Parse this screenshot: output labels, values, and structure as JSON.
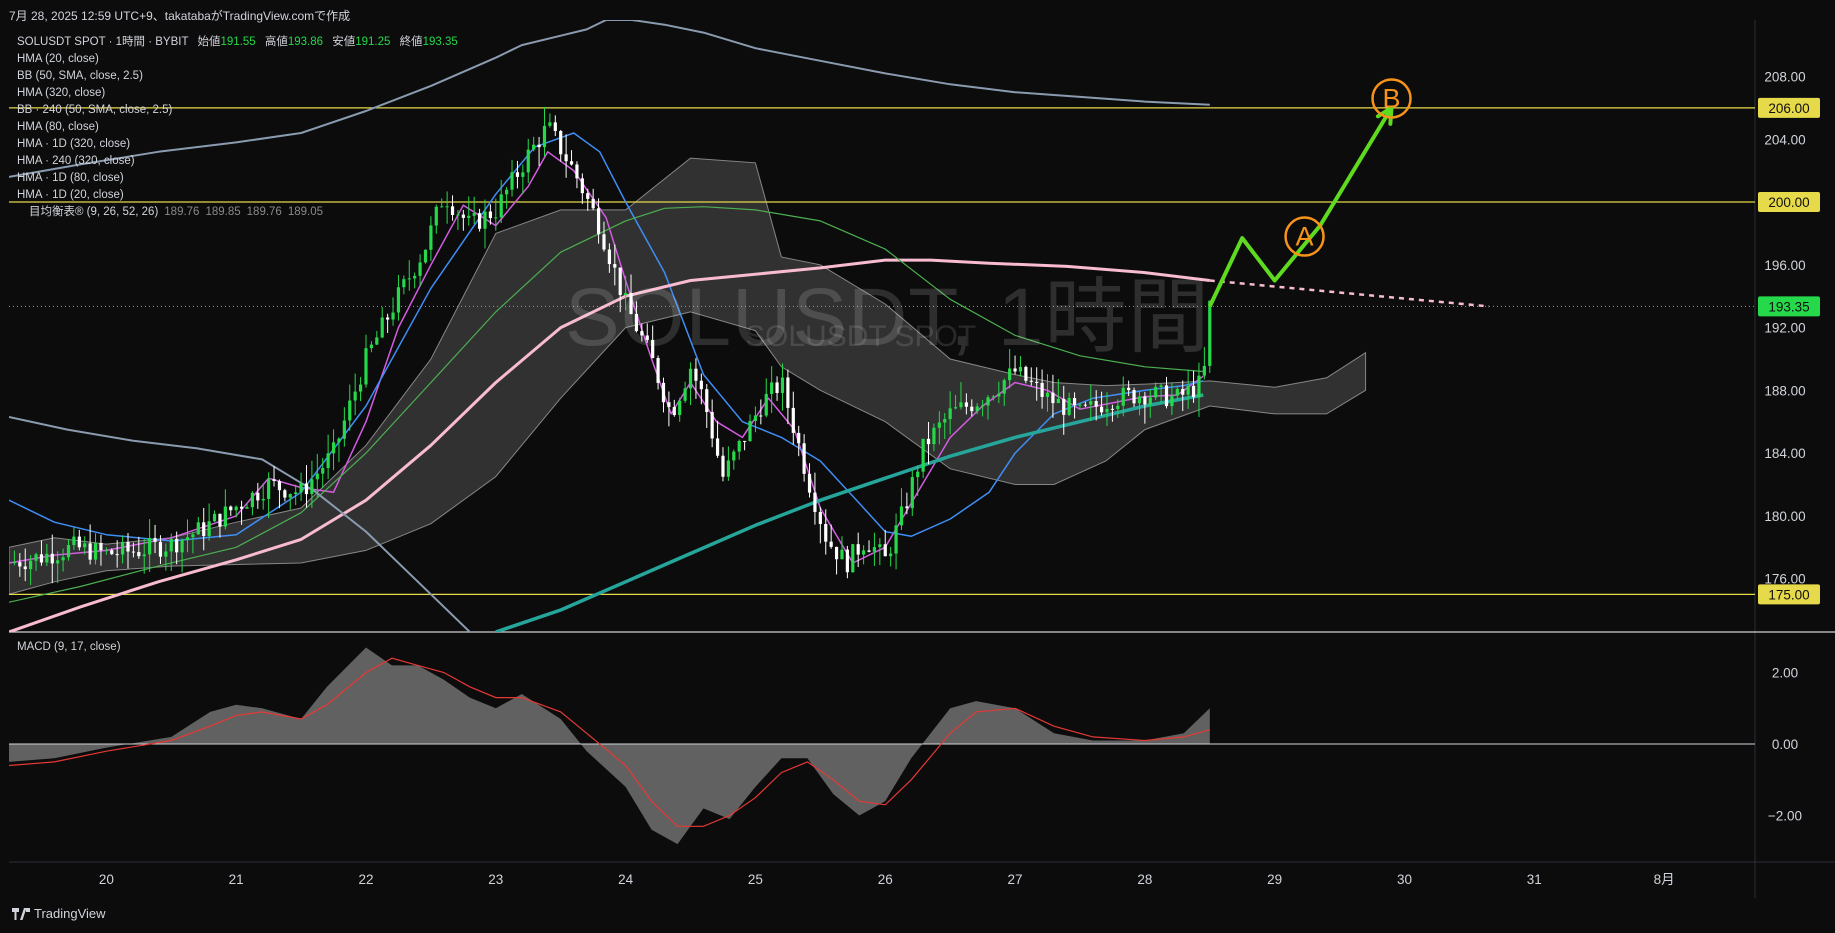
{
  "header": {
    "caption": "7月 28, 2025 12:59 UTC+9、takatabaがTradingView.comで作成"
  },
  "legend": {
    "symbol_line": "SOLUSDT SPOT · 1時間 · BYBIT",
    "open_label": "始値",
    "open": "191.55",
    "high_label": "高値",
    "high": "193.86",
    "low_label": "安値",
    "low": "191.25",
    "close_label": "終値",
    "close": "193.35",
    "indicators": [
      "HMA (20, close)",
      "BB (50, SMA, close, 2.5)",
      "HMA (320, close)",
      "BB · 240 (50, SMA, close, 2.5)",
      "HMA (80, close)",
      "HMA · 1D (320, close)",
      "HMA · 240 (320, close)",
      "HMA · 1D (80, close)",
      "HMA · 1D (20, close)"
    ],
    "ichimoku_label": "目均衡表® (9, 26, 52, 26)",
    "ichimoku_values": [
      "189.76",
      "189.85",
      "189.76",
      "189.05"
    ]
  },
  "macd_label": "MACD (9, 17, close)",
  "watermark": {
    "main": "SOLUSDT, 1時間",
    "sub": "SOLUSDT SPOT"
  },
  "footer": {
    "brand": "TradingView"
  },
  "colors": {
    "background": "#0c0c0c",
    "bull": "#26d94a",
    "bear": "#ffffff",
    "hma20": "#d35ce0",
    "hma80": "#3f8ef5",
    "hma320": "#f8bbd0",
    "bb_outer": "#8a9bb0",
    "bb_mid": "#4caf50",
    "teal": "#26a69a",
    "level": "#e6d94a",
    "projection": "#5edb1f",
    "label_orange": "#f7931a",
    "current_price_bg": "#26d94a"
  },
  "chart_data": [
    {
      "type": "candlestick",
      "title": "SOLUSDT, 1時間",
      "x_ticks": [
        "20",
        "21",
        "22",
        "23",
        "24",
        "25",
        "26",
        "27",
        "28",
        "29",
        "30",
        "31",
        "8月"
      ],
      "y_ticks": [
        176.0,
        180.0,
        184.0,
        188.0,
        192.0,
        196.0,
        200.0,
        204.0,
        208.0
      ],
      "y_tick_labels": [
        "176.00",
        "180.00",
        "184.00",
        "188.00",
        "192.00",
        "196.00",
        "200.00",
        "204.00",
        "208.00"
      ],
      "ylim": [
        172.6,
        211.6
      ],
      "xlim": [
        19.25,
        32.7
      ],
      "grid": false,
      "price_levels": [
        {
          "value": 206.0,
          "label": "206.00"
        },
        {
          "value": 200.0,
          "label": "200.00"
        },
        {
          "value": 175.0,
          "label": "175.00"
        }
      ],
      "current_price": {
        "value": 193.35,
        "label": "193.35"
      },
      "close_path": [
        [
          19.25,
          177.0
        ],
        [
          19.5,
          177.4
        ],
        [
          19.75,
          178.0
        ],
        [
          20.0,
          177.6
        ],
        [
          20.25,
          177.8
        ],
        [
          20.5,
          178.2
        ],
        [
          20.75,
          179.2
        ],
        [
          21.0,
          180.6
        ],
        [
          21.25,
          182.0
        ],
        [
          21.5,
          181.5
        ],
        [
          21.75,
          184.0
        ],
        [
          22.0,
          190.0
        ],
        [
          22.25,
          194.0
        ],
        [
          22.45,
          197.0
        ],
        [
          22.6,
          200.5
        ],
        [
          22.8,
          198.5
        ],
        [
          23.0,
          199.5
        ],
        [
          23.25,
          203.0
        ],
        [
          23.4,
          204.8
        ],
        [
          23.6,
          202.0
        ],
        [
          23.8,
          198.5
        ],
        [
          24.0,
          193.5
        ],
        [
          24.2,
          190.0
        ],
        [
          24.35,
          186.5
        ],
        [
          24.5,
          189.5
        ],
        [
          24.6,
          187.5
        ],
        [
          24.75,
          182.5
        ],
        [
          24.9,
          184.8
        ],
        [
          25.05,
          187.2
        ],
        [
          25.2,
          188.5
        ],
        [
          25.4,
          182.5
        ],
        [
          25.55,
          178.5
        ],
        [
          25.7,
          177.0
        ],
        [
          25.85,
          178.5
        ],
        [
          26.0,
          177.2
        ],
        [
          26.15,
          180.5
        ],
        [
          26.3,
          184.5
        ],
        [
          26.5,
          186.5
        ],
        [
          26.75,
          187.5
        ],
        [
          27.0,
          189.2
        ],
        [
          27.25,
          187.5
        ],
        [
          27.5,
          186.5
        ],
        [
          27.75,
          187.5
        ],
        [
          28.0,
          187.8
        ],
        [
          28.25,
          187.5
        ],
        [
          28.45,
          188.5
        ],
        [
          28.5,
          193.35
        ]
      ],
      "series": [
        {
          "name": "HMA (20, close)",
          "x": [
            19.25,
            19.6,
            20.0,
            20.5,
            21.0,
            21.25,
            21.5,
            21.75,
            22.0,
            22.25,
            22.5,
            22.75,
            23.0,
            23.25,
            23.4,
            23.6,
            23.85,
            24.0,
            24.2,
            24.35,
            24.5,
            24.7,
            24.9,
            25.1,
            25.3,
            25.5,
            25.75,
            26.0,
            26.25,
            26.5,
            26.75,
            27.0,
            27.25,
            27.5,
            27.75,
            28.0,
            28.25,
            28.45
          ],
          "y": [
            177.0,
            177.5,
            177.8,
            178.6,
            180.0,
            182.4,
            181.8,
            181.5,
            186.0,
            192.0,
            196.0,
            199.8,
            198.5,
            201.0,
            203.2,
            202.0,
            199.0,
            195.0,
            190.0,
            186.5,
            188.5,
            186.0,
            185.0,
            187.5,
            185.5,
            180.5,
            177.0,
            178.0,
            181.5,
            185.0,
            187.0,
            188.5,
            188.0,
            186.8,
            187.2,
            187.6,
            187.7,
            188.9
          ]
        },
        {
          "name": "HMA (80, close)",
          "x": [
            19.25,
            19.6,
            20.0,
            20.5,
            21.0,
            21.5,
            22.0,
            22.5,
            23.0,
            23.3,
            23.6,
            23.8,
            24.0,
            24.3,
            24.6,
            24.9,
            25.2,
            25.5,
            25.8,
            26.0,
            26.2,
            26.5,
            26.8,
            27.0,
            27.3,
            27.6,
            28.0,
            28.3,
            28.45
          ],
          "y": [
            181.0,
            179.6,
            178.8,
            178.4,
            178.8,
            181.5,
            187.0,
            194.5,
            200.5,
            203.5,
            204.4,
            203.2,
            200.0,
            195.5,
            189.0,
            186.0,
            185.0,
            183.5,
            180.8,
            179.0,
            178.7,
            179.8,
            181.5,
            184.0,
            186.5,
            187.5,
            188.0,
            188.3,
            188.6
          ]
        },
        {
          "name": "HMA (320, close)",
          "x": [
            19.25,
            19.8,
            20.4,
            21.0,
            21.5,
            22.0,
            22.5,
            23.0,
            23.5,
            24.0,
            24.5,
            25.0,
            25.5,
            26.0,
            26.35,
            26.8,
            27.4,
            28.0,
            28.5
          ],
          "y": [
            172.6,
            174.2,
            175.8,
            177.2,
            178.5,
            181.0,
            184.5,
            188.5,
            192.0,
            194.0,
            195.0,
            195.4,
            195.8,
            196.3,
            196.3,
            196.1,
            195.9,
            195.5,
            195.0
          ]
        },
        {
          "name": "BB (50) upper",
          "x": [
            19.25,
            19.8,
            20.4,
            21.0,
            21.5,
            22.0,
            22.5,
            23.0,
            23.2,
            23.5,
            23.7,
            23.85,
            24.05,
            24.3,
            24.6,
            25.0,
            25.5,
            26.0,
            26.5,
            27.0,
            27.5,
            28.0,
            28.5
          ],
          "y": [
            201.6,
            202.4,
            203.2,
            203.8,
            204.4,
            205.8,
            207.4,
            209.2,
            210.0,
            210.6,
            211.0,
            211.6,
            211.6,
            211.3,
            210.8,
            209.8,
            209.0,
            208.2,
            207.5,
            207.0,
            206.7,
            206.4,
            206.2
          ]
        },
        {
          "name": "BB (50) middle",
          "x": [
            19.25,
            19.8,
            20.4,
            21.0,
            21.5,
            22.0,
            22.5,
            23.0,
            23.5,
            24.0,
            24.3,
            24.6,
            25.0,
            25.5,
            26.0,
            26.5,
            27.0,
            27.5,
            28.0,
            28.45
          ],
          "y": [
            174.5,
            175.5,
            176.8,
            178.0,
            180.2,
            184.0,
            188.5,
            193.0,
            196.8,
            198.8,
            199.6,
            199.7,
            199.5,
            198.8,
            197.0,
            193.8,
            191.5,
            190.2,
            189.5,
            189.2
          ]
        },
        {
          "name": "BB (50) lower",
          "x": [
            19.25,
            19.7,
            20.2,
            20.7,
            21.2,
            21.6,
            22.0,
            22.5,
            23.0,
            23.5,
            24.0
          ],
          "y": [
            186.3,
            185.5,
            184.8,
            184.3,
            183.6,
            181.6,
            179.0,
            175.0,
            171.0,
            167.0,
            163.0
          ]
        },
        {
          "name": "HMA · 1D (80, close)",
          "x": [
            23.0,
            23.5,
            24.0,
            24.5,
            25.0,
            25.5,
            26.0,
            26.5,
            27.0,
            27.5,
            28.0,
            28.45
          ],
          "y": [
            172.6,
            174.0,
            175.8,
            177.6,
            179.4,
            181.0,
            182.4,
            183.8,
            185.0,
            186.0,
            187.0,
            187.7
          ]
        }
      ],
      "ichimoku_cloud": {
        "x": [
          19.25,
          19.6,
          20.0,
          20.5,
          21.0,
          21.5,
          22.0,
          22.5,
          23.0,
          23.5,
          24.0,
          24.5,
          25.0,
          25.2,
          25.5,
          26.0,
          26.5,
          27.0,
          27.3,
          27.7,
          28.0,
          28.5,
          29.0,
          29.4,
          29.7
        ],
        "top": [
          178.0,
          178.6,
          178.2,
          178.6,
          179.6,
          180.5,
          184.5,
          190.0,
          198.0,
          199.5,
          199.5,
          202.8,
          202.5,
          196.5,
          196.0,
          193.5,
          190.0,
          189.0,
          188.5,
          188.3,
          188.4,
          188.6,
          188.2,
          188.8,
          190.4
        ],
        "bottom": [
          175.0,
          175.8,
          176.5,
          176.8,
          176.9,
          177.0,
          177.8,
          179.5,
          182.5,
          187.5,
          192.0,
          193.0,
          191.8,
          189.5,
          188.0,
          186.0,
          183.0,
          182.0,
          182.0,
          183.5,
          185.5,
          187.0,
          186.5,
          186.5,
          188.0
        ]
      },
      "projection": {
        "x": [
          28.5,
          28.75,
          29.0,
          29.35,
          29.9
        ],
        "y": [
          193.35,
          197.7,
          195.0,
          198.5,
          206.0
        ]
      },
      "wave_labels": [
        {
          "text": "A",
          "x": 29.23,
          "y": 197.8
        },
        {
          "text": "B",
          "x": 29.9,
          "y": 206.6
        }
      ]
    },
    {
      "type": "area",
      "title": "MACD (9, 17, close)",
      "y_ticks": [
        2.0,
        0.0,
        -2.0
      ],
      "y_tick_labels": [
        "2.00",
        "0.00",
        "−2.00"
      ],
      "ylim": [
        -3.3,
        3.05
      ],
      "x": [
        19.25,
        19.6,
        20.0,
        20.5,
        20.8,
        21.0,
        21.2,
        21.5,
        21.7,
        22.0,
        22.2,
        22.4,
        22.6,
        22.8,
        23.0,
        23.2,
        23.5,
        23.7,
        24.0,
        24.2,
        24.4,
        24.6,
        24.8,
        25.0,
        25.2,
        25.4,
        25.6,
        25.8,
        26.0,
        26.2,
        26.5,
        26.7,
        27.0,
        27.3,
        27.6,
        28.0,
        28.3,
        28.5
      ],
      "macd": [
        -0.5,
        -0.4,
        -0.1,
        0.2,
        0.9,
        1.1,
        1.0,
        0.7,
        1.6,
        2.7,
        2.2,
        2.2,
        1.8,
        1.3,
        1.0,
        1.4,
        0.7,
        -0.2,
        -1.2,
        -2.4,
        -2.8,
        -1.8,
        -2.1,
        -1.2,
        -0.4,
        -0.4,
        -1.4,
        -2.0,
        -1.6,
        -0.4,
        1.0,
        1.2,
        1.0,
        0.3,
        0.1,
        0.1,
        0.3,
        1.0
      ],
      "signal": [
        -0.6,
        -0.5,
        -0.2,
        0.1,
        0.5,
        0.8,
        0.9,
        0.7,
        1.1,
        2.0,
        2.4,
        2.2,
        2.0,
        1.6,
        1.3,
        1.3,
        0.9,
        0.3,
        -0.6,
        -1.6,
        -2.3,
        -2.3,
        -2.0,
        -1.5,
        -0.8,
        -0.5,
        -1.0,
        -1.6,
        -1.7,
        -1.0,
        0.3,
        0.9,
        1.0,
        0.5,
        0.2,
        0.1,
        0.2,
        0.4
      ]
    }
  ]
}
